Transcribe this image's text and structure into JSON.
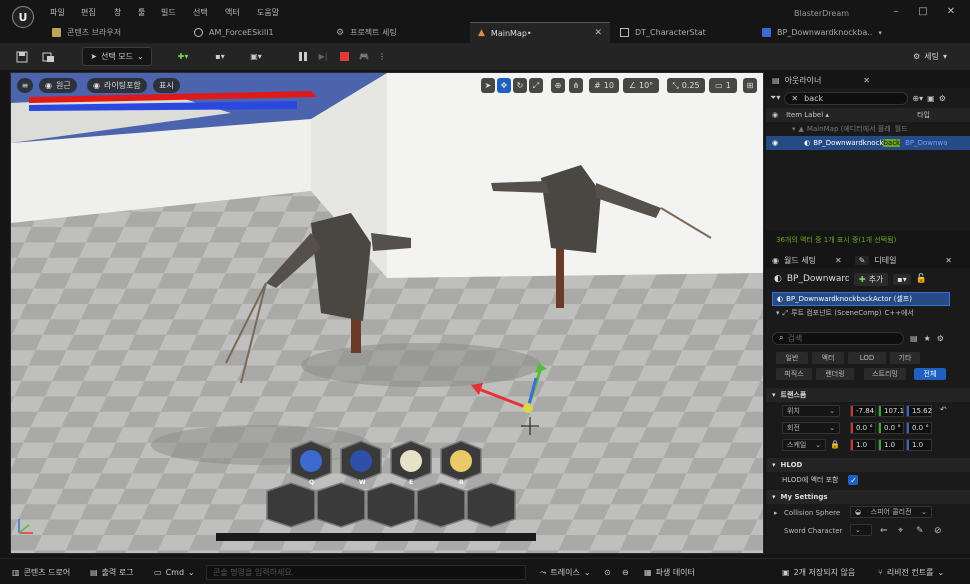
{
  "menu": {
    "items": [
      "파일",
      "편집",
      "창",
      "툴",
      "빌드",
      "선택",
      "액터",
      "도움말"
    ]
  },
  "window": {
    "title": "BlasterDream",
    "minimize": "–",
    "maximize": "□",
    "close": "✕"
  },
  "tabs": [
    {
      "label": "콘텐츠 브라우저",
      "icon": "folder-icon"
    },
    {
      "label": "AM_ForceESkill1",
      "icon": "animation-icon"
    },
    {
      "label": "프로젝트 세팅",
      "icon": "gear-icon"
    },
    {
      "label": "MainMap•",
      "icon": "level-icon",
      "active": true
    },
    {
      "label": "DT_CharacterStat",
      "icon": "table-icon"
    },
    {
      "label": "BP_Downwardknockba..",
      "icon": "blueprint-icon"
    }
  ],
  "toolbar": {
    "mode_label": "선택 모드",
    "settings_label": "세팅"
  },
  "viewport": {
    "perspective_label": "원근",
    "lighting_label": "라이팅포함",
    "show_label": "표시",
    "grid_snap": "10",
    "rot_snap": "10°",
    "scale_snap": "0.25",
    "camera_speed": "1",
    "skills": [
      "Q",
      "W",
      "E",
      "R"
    ]
  },
  "outliner": {
    "title": "아웃라이너",
    "search_value": "back",
    "col_label": "Item Label ▴",
    "col_type": "타입",
    "world_row": "MainMap (에디터에서 플레",
    "world_type": "월드",
    "actor_name_a": "BP_Downwardknock",
    "actor_name_hl": "back",
    "actor_type": "BP_Downwa",
    "status": "36개의 액터 중 1개 표시 중(1개 선택됨)"
  },
  "details": {
    "tab_world": "월드 세팅",
    "tab_details": "디테일",
    "actor_name": "BP_Downward",
    "add_label": "추가",
    "component_root": "BP_DownwardknockbackActor (셀프)",
    "component_child": "루트 컴포넌트 (SceneComp)",
    "component_child_tag": "C++에서",
    "search_placeholder": "검색",
    "filters": [
      "일반",
      "액터",
      "LOD",
      "기타",
      "피직스",
      "렌더링",
      "스트리밍",
      "전체"
    ],
    "transform_title": "트랜스폼",
    "location_label": "위치",
    "rotation_label": "회전",
    "scale_label": "스케일",
    "location": [
      "-7.84",
      "107.1",
      "15.62"
    ],
    "rotation": [
      "0.0 °",
      "0.0 °",
      "0.0 °"
    ],
    "scale": [
      "1.0",
      "1.0",
      "1.0"
    ],
    "hlod_title": "HLOD",
    "hlod_prop": "HLOD에 액터 포함",
    "mysettings_title": "My Settings",
    "collision_label": "Collision Sphere",
    "collision_value": "스피어 콜리전",
    "sword_label": "Sword Character"
  },
  "statusbar": {
    "content_drawer": "콘텐츠 드로어",
    "output_log": "출력 로그",
    "cmd": "Cmd",
    "cmd_placeholder": "콘솔 명령을 입력하세요.",
    "trace": "트레이스",
    "derived_data": "파생 데이터",
    "unsaved": "2개 저장되지 않음",
    "revision": "리비전 컨트롤"
  }
}
